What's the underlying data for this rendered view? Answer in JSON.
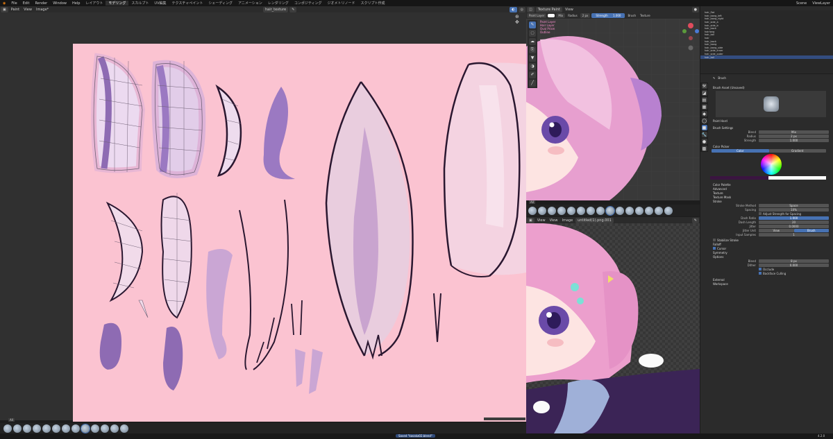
{
  "menubar": {
    "menus": [
      "File",
      "Edit",
      "Render",
      "Window",
      "Help"
    ],
    "workspaces": [
      "レイアウト",
      "モデリング",
      "スカルプト",
      "UV編集",
      "テクスチャペイント",
      "シェーディング",
      "アニメーション",
      "レンダリング",
      "コンポジティング",
      "ジオメトリノード",
      "スクリプト作成"
    ],
    "active_workspace": "モデリング",
    "scene_label": "Scene",
    "viewlayer_label": "ViewLayer"
  },
  "image_editor": {
    "header": [
      "Paint",
      "View",
      "Image*"
    ],
    "image_name": "hair_texture",
    "bottom_tab": "All"
  },
  "viewport": {
    "mode": "Texture Paint",
    "view_menu": "View",
    "header_fields": {
      "texture_slot": "Paint Layer",
      "blend": "Mix",
      "radius_label": "Radius",
      "radius": "2 px",
      "strength_label": "Strength",
      "strength": "1.000",
      "brush_label": "Brush",
      "texture_label": "Texture"
    },
    "overlay_text": [
      "Paint Layer",
      "Hair Layer",
      "Oval Prism",
      "Outline"
    ],
    "bottom_tab": "All"
  },
  "lower_image_editor": {
    "header": [
      "View",
      "View",
      "Image"
    ],
    "image_name": "untitled(1).png.001",
    "bottom_tab": "All"
  },
  "outliner": {
    "rows": [
      "hair_flat",
      "hair_bang_left",
      "hair_bang_right",
      "hair_side_a",
      "hair_side_b",
      "hair_back",
      "hairlong",
      "hair_tail",
      "hair",
      "hair_back",
      "hair_bang",
      "hair_bang_side",
      "hair_side_inner",
      "hair_side_outer",
      "hair_tail"
    ],
    "selected_index": 14
  },
  "properties": {
    "section_brush": "Brush",
    "brush_asset_label": "Brush Asset (Unsaved)",
    "brush_name": "Paint Hard",
    "brush_settings": "Brush Settings",
    "blend_label": "Blend",
    "blend_value": "Mix",
    "radius_label": "Radius",
    "radius_value": "2 px",
    "strength_label": "Strength",
    "strength_value": "1.000",
    "color_picker": "Color Picker",
    "tabs": [
      "Color",
      "Gradient"
    ],
    "active_tab": "Color",
    "collapsed_panels": [
      "Color Palette",
      "Advanced",
      "Texture",
      "Texture Mask"
    ],
    "stroke_label": "Stroke",
    "stroke_method_label": "Stroke Method",
    "stroke_method_value": "Space",
    "spacing_label": "Spacing",
    "spacing_value": "10%",
    "adjust_strength": "Adjust Strength for Spacing",
    "dash_ratio_label": "Dash Ratio",
    "dash_ratio_value": "1.000",
    "dash_length_label": "Dash Length",
    "dash_length_value": "20",
    "jitter_label": "Jitter",
    "jitter_value": "0.0000",
    "jitter_unit_label": "Jitter Unit",
    "jitter_unit_options": [
      "View",
      "Brush"
    ],
    "input_samples_label": "Input Samples",
    "input_samples_value": "1",
    "stabilize_label": "Stabilize Stroke",
    "falloff_label": "Falloff",
    "cursor_label": "Cursor",
    "symmetry_label": "Symmetry",
    "options_label": "Options",
    "bleed_label": "Bleed",
    "bleed_value": "8 px",
    "dither_label": "Dither",
    "dither_value": "0.000",
    "occlude_label": "Occlude",
    "backface_label": "Backface Culling",
    "external_label": "External",
    "workspace_label": "Workspace"
  },
  "statusbar": {
    "message": "Saved \"kasaka02.blend\"",
    "version": "4.2.0"
  },
  "colors": {
    "canvas_pink": "#fbc3d1",
    "hair_lilac": "#b48ec3",
    "brush_purple": "#8e6bb3",
    "outline": "#2a1730",
    "blender_blue": "#4772b3",
    "selected_row": "#334d80"
  }
}
